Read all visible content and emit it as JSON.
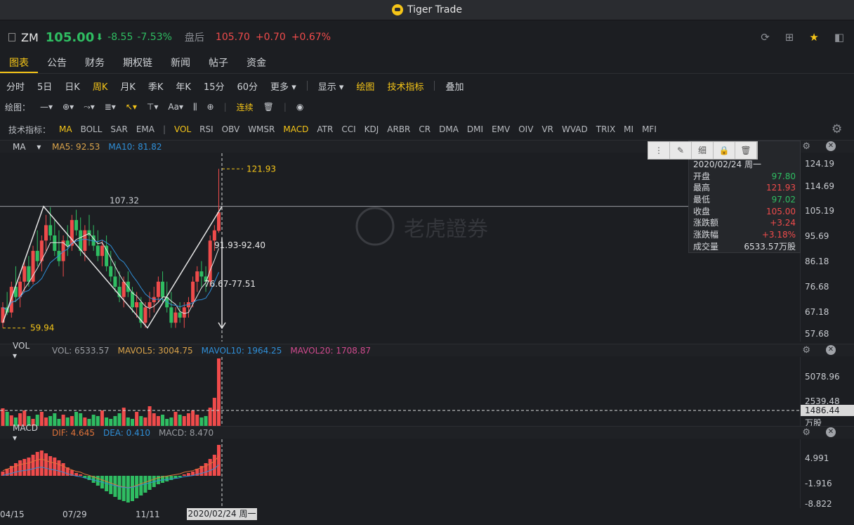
{
  "app": {
    "title": "Tiger Trade"
  },
  "quote": {
    "symbol": "ZM",
    "price": "105.00",
    "arrow": "⬇",
    "change": "-8.55",
    "change_pct": "-7.53%",
    "after_hours_label": "盘后",
    "after_hours_price": "105.70",
    "after_hours_change": "+0.70",
    "after_hours_pct": "+0.67%"
  },
  "tabs": [
    "图表",
    "公告",
    "财务",
    "期权链",
    "新闻",
    "帖子",
    "资金"
  ],
  "active_tab": "图表",
  "periods": [
    "分时",
    "5日",
    "日K",
    "周K",
    "月K",
    "季K",
    "年K",
    "15分",
    "60分",
    "更多"
  ],
  "active_period": "周K",
  "period_tools": {
    "display": "显示",
    "draw": "绘图",
    "indicators": "技术指标",
    "overlay": "叠加"
  },
  "draw_bar": {
    "label": "绘图：",
    "continuous": "连续"
  },
  "indicator_bar": {
    "label": "技术指标：",
    "main": [
      "MA",
      "BOLL",
      "SAR",
      "EMA"
    ],
    "sub": [
      "VOL",
      "RSI",
      "OBV",
      "WMSR",
      "MACD",
      "ATR",
      "CCI",
      "KDJ",
      "ARBR",
      "CR",
      "DMA",
      "DMI",
      "EMV",
      "OIV",
      "VR",
      "WVAD",
      "TRIX",
      "MI",
      "MFI"
    ]
  },
  "ma_panel": {
    "name": "MA",
    "ma5": "MA5: 92.53",
    "ma10": "MA10: 81.82",
    "axis": [
      "124.19",
      "114.69",
      "105.19",
      "95.69",
      "86.18",
      "76.68",
      "67.18",
      "57.68"
    ],
    "high_marker": "121.93",
    "low_marker": "59.94",
    "line_label": "107.32",
    "annot1": "91.93-92.40",
    "annot2": "76.67-77.51",
    "watermark": "老虎證券"
  },
  "tooltip": {
    "tools": [
      "细"
    ],
    "date": "2020/02/24 周一",
    "rows": [
      {
        "label": "开盘",
        "value": "97.80",
        "color": "#2fbd62"
      },
      {
        "label": "最高",
        "value": "121.93",
        "color": "#ef4b4b"
      },
      {
        "label": "最低",
        "value": "97.02",
        "color": "#2fbd62"
      },
      {
        "label": "收盘",
        "value": "105.00",
        "color": "#ef4b4b"
      },
      {
        "label": "涨跌额",
        "value": "+3.24",
        "color": "#ef4b4b"
      },
      {
        "label": "涨跌幅",
        "value": "+3.18%",
        "color": "#ef4b4b"
      },
      {
        "label": "成交量",
        "value": "6533.57万股",
        "color": "#d9dbdf"
      }
    ]
  },
  "vol_panel": {
    "name": "VOL",
    "vol": "VOL: 6533.57",
    "mavol5": "MAVOL5: 3004.75",
    "mavol10": "MAVOL10: 1964.25",
    "mavol20": "MAVOL20: 1708.87",
    "axis": [
      "5078.96",
      "2539.48"
    ],
    "cursor_value": "1486.44",
    "unit": "万股"
  },
  "macd_panel": {
    "name": "MACD",
    "dif": "DIF: 4.645",
    "dea": "DEA: 0.410",
    "macd": "MACD: 8.470",
    "axis": [
      "4.991",
      "-1.916",
      "-8.822"
    ]
  },
  "x_axis": {
    "labels": [
      "04/15",
      "07/29",
      "11/11"
    ],
    "cursor_date": "2020/02/24 周一"
  },
  "colors": {
    "up": "#ef4b4b",
    "down": "#2fbd62",
    "accent": "#f5c518",
    "ma5": "#e8e8e8",
    "ma10": "#2f8fd8"
  }
}
